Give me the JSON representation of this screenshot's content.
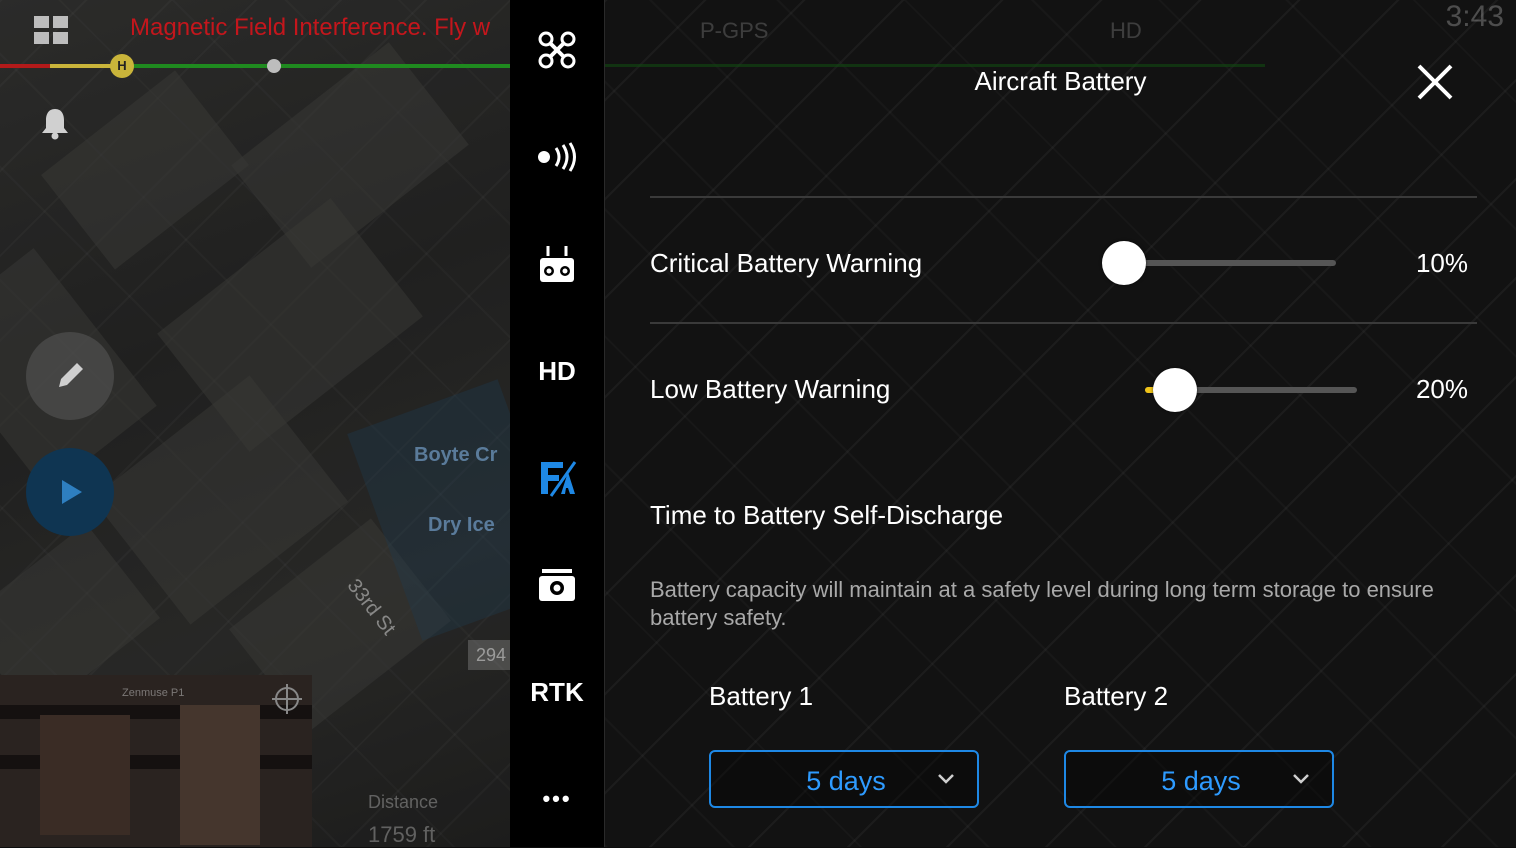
{
  "map": {
    "warning_text": "Magnetic Field Interference. Fly w",
    "home_marker": "H",
    "labels": {
      "place1": "Boyte Cr",
      "place2": "Dry Ice",
      "street": "33rd St",
      "scale": "294"
    },
    "fpv_camera": "Zenmuse P1",
    "distance_label": "Distance",
    "distance_value": "1759 ft"
  },
  "sidebar": {
    "items": [
      {
        "name": "aircraft",
        "icon": "drone-icon"
      },
      {
        "name": "sensors",
        "icon": "signal-icon"
      },
      {
        "name": "remote-controller",
        "icon": "remote-controller-icon"
      },
      {
        "name": "video-link",
        "label": "HD"
      },
      {
        "name": "battery",
        "icon": "battery-settings-icon",
        "active": true
      },
      {
        "name": "camera",
        "icon": "camera-icon"
      },
      {
        "name": "rtk",
        "label": "RTK"
      },
      {
        "name": "more",
        "label": "•••"
      }
    ]
  },
  "status_bar": {
    "gps": "P-GPS",
    "video": "HD",
    "time": "3:43"
  },
  "panel": {
    "title": "Aircraft Battery",
    "critical": {
      "label": "Critical Battery Warning",
      "value": "10%",
      "fraction": 0.0
    },
    "low": {
      "label": "Low Battery Warning",
      "value": "20%",
      "fraction": 0.14
    },
    "self_discharge": {
      "title": "Time to Battery Self-Discharge",
      "description": "Battery capacity will maintain at a safety level during long term storage to ensure battery safety."
    },
    "batteries": [
      {
        "label": "Battery 1",
        "value": "5 days"
      },
      {
        "label": "Battery 2",
        "value": "5 days"
      }
    ]
  },
  "colors": {
    "accent": "#1e88e5",
    "warning": "#c4161c",
    "slider_fill": "#f0c419",
    "active_icon": "#1e88e5"
  }
}
